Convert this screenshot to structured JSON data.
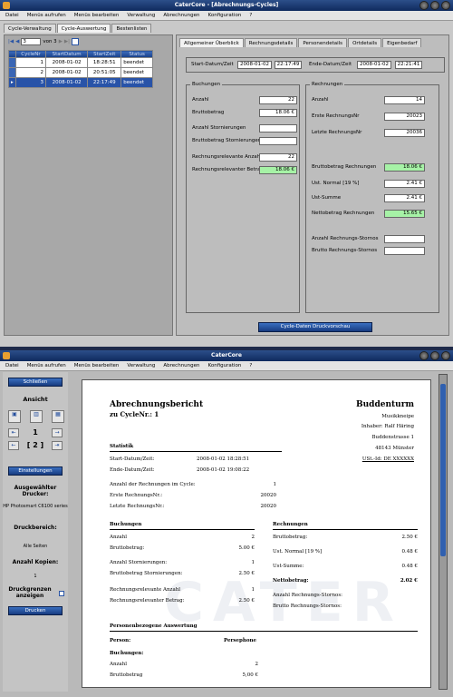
{
  "top_window": {
    "title": "CaterCore - [Abrechnungs-Cycles]",
    "menu": [
      "Datei",
      "Menüs aufrufen",
      "Menüs bearbeiten",
      "Verwaltung",
      "Abrechnungen",
      "Konfiguration",
      "?"
    ],
    "main_tabs": [
      "Cycle-Verwaltung",
      "Cycle-Auswertung",
      "Bestenlisten"
    ],
    "navigator": {
      "position": "3",
      "of_text": "von 3"
    },
    "grid": {
      "columns": [
        "CycleNr",
        "StartDatum",
        "StartZeit",
        "Status"
      ],
      "rows": [
        {
          "nr": "1",
          "date": "2008-01-02",
          "time": "18:28:51",
          "status": "beendet"
        },
        {
          "nr": "2",
          "date": "2008-01-02",
          "time": "20:51:05",
          "status": "beendet"
        },
        {
          "nr": "3",
          "date": "2008-01-02",
          "time": "22:17:49",
          "status": "beendet"
        }
      ]
    },
    "detail_tabs": [
      "Allgemeiner Überblick",
      "Rechnungsdetails",
      "Personendetails",
      "Ortdetails",
      "Eigenbedarf"
    ],
    "start_label": "Start-Datum/Zeit",
    "start_date": "2008-01-02",
    "start_time": "22:17:49",
    "end_label": "Ende-Datum/Zeit",
    "end_date": "2008-01-02",
    "end_time": "22:21:41",
    "buchungen": {
      "title": "Buchungen",
      "anzahl_label": "Anzahl",
      "anzahl": "22",
      "brutto_label": "Bruttobetrag",
      "brutto": "18.06 €",
      "storno_anzahl_label": "Anzahl Stornierungen",
      "storno_anzahl": "",
      "storno_brutto_label": "Bruttobetrag Stornierungen",
      "storno_brutto": "",
      "rel_anzahl_label": "Rechnungsrelevante Anzahl",
      "rel_anzahl": "22",
      "rel_brutto_label": "Rechnungsrelevanter Betrag",
      "rel_brutto": "18.06 €"
    },
    "rechnungen": {
      "title": "Rechnungen",
      "anzahl_label": "Anzahl",
      "anzahl": "14",
      "erste_label": "Erste RechnungsNr",
      "erste": "20023",
      "letzte_label": "Letzte RechnungsNr",
      "letzte": "20036",
      "brutto_label": "Bruttobetrag Rechnungen",
      "brutto": "18.06 €",
      "ust_label": "Ust. Normal [19 %]",
      "ust": "2.41 €",
      "ust_summe_label": "Ust-Summe",
      "ust_summe": "2.41 €",
      "netto_label": "Nettobetrag Rechnungen",
      "netto": "15.65 €",
      "storno_anzahl_label": "Anzahl Rechnungs-Stornos",
      "storno_anzahl": "",
      "storno_brutto_label": "Brutto Rechnungs-Stornos",
      "storno_brutto": ""
    },
    "print_button": "Cycle-Daten Druckvorschau"
  },
  "bottom_window": {
    "title": "CaterCore",
    "menu": [
      "Datei",
      "Menüs aufrufen",
      "Menüs bearbeiten",
      "Verwaltung",
      "Abrechnungen",
      "Konfiguration",
      "?"
    ],
    "sidebar": {
      "close_button": "Schließen",
      "ansicht": "Ansicht",
      "page": "1",
      "pages": "[ 2 ]",
      "settings_button": "Einstellungen",
      "printer_heading": "Ausgewählter Drucker:",
      "printer_name": "HP Photosmart C6100 series",
      "range_heading": "Druckbereich:",
      "range_value": "Alle Seiten",
      "copies_heading": "Anzahl Kopien:",
      "copies_value": "1",
      "margins_label": "Druckgrenzen anzeigen",
      "print_button": "Drucken"
    },
    "report": {
      "title": "Abrechnungsbericht",
      "subtitle": "zu CycleNr.: 1",
      "company": "Buddenturm",
      "company_sub": "Musikkneipe",
      "owner": "Inhaber: Ralf Häring",
      "street": "Buddenstrasse 1",
      "city": "48143 Münster",
      "ust_id": "USt.-Id: DE XXXXXX",
      "statistik_heading": "Statistik",
      "start_label": "Start-Datum/Zeit:",
      "start_value": "2008-01-02  18:28:51",
      "end_label": "Ende-Datum/Zeit:",
      "end_value": "2008-01-02  19:08:22",
      "count_label": "Anzahl der Rechnungen im Cycle:",
      "count_value": "1",
      "first_label": "Erste RechnungsNr.:",
      "first_value": "20020",
      "last_label": "Letzte RechnungsNr.:",
      "last_value": "20020",
      "buchungen_heading": "Buchungen",
      "b_anzahl_label": "Anzahl",
      "b_anzahl": "2",
      "b_brutto_label": "Bruttobetrag:",
      "b_brutto": "5.00 €",
      "b_storno_label": "Anzahl Stornierungen:",
      "b_storno": "1",
      "b_storno_brutto_label": "Bruttobetrag Stornierungen:",
      "b_storno_brutto": "2.50 €",
      "b_rel_label": "Rechnungsrelevante Anzahl",
      "b_rel": "1",
      "b_rel_brutto_label": "Rechnungsrelevanter Betrag:",
      "b_rel_brutto": "2.50 €",
      "rechnungen_heading": "Rechnungen",
      "r_brutto_label": "Bruttobetrag:",
      "r_brutto": "2.50 €",
      "r_ust_label": "Ust. Normal [19 %]",
      "r_ust": "0.48 €",
      "r_summe_label": "Ust-Summe:",
      "r_summe": "0.48 €",
      "r_netto_label": "Nettobetrag:",
      "r_netto": "2.02 €",
      "r_storno_label": "Anzahl Rechnungs-Stornos:",
      "r_storno_brutto_label": "Brutto Rechnungs-Stornos:",
      "personen_heading": "Personenbezogene Auswertung",
      "person_label": "Person:",
      "person_value": "Persephone",
      "p_buchungen": "Buchungen:",
      "p_anzahl_label": "Anzahl",
      "p_anzahl": "2",
      "p_brutto_label": "Bruttobetrag",
      "p_brutto": "5,00 €",
      "watermark": "CATER"
    }
  }
}
